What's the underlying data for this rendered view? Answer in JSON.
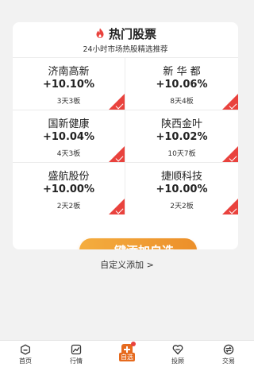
{
  "header": {
    "title": "热门股票",
    "subtitle": "24小时市场热股精选推荐"
  },
  "stocks": [
    {
      "name": "济南高新",
      "change": "+10.10%",
      "streak": "3天3板",
      "selected": true
    },
    {
      "name": "新 华 都",
      "change": "+10.06%",
      "streak": "8天4板",
      "selected": true
    },
    {
      "name": "国新健康",
      "change": "+10.04%",
      "streak": "4天3板",
      "selected": true
    },
    {
      "name": "陕西金叶",
      "change": "+10.02%",
      "streak": "10天7板",
      "selected": true
    },
    {
      "name": "盛航股份",
      "change": "+10.00%",
      "streak": "2天2板",
      "selected": true
    },
    {
      "name": "捷顺科技",
      "change": "+10.00%",
      "streak": "2天2板",
      "selected": true
    }
  ],
  "actions": {
    "add_all_label": "一键添加自选",
    "custom_add_label": "自定义添加 >"
  },
  "tabbar": {
    "items": [
      {
        "label": "首页",
        "icon": "home-icon"
      },
      {
        "label": "行情",
        "icon": "chart-icon"
      },
      {
        "label": "自选",
        "icon": "plus-square-icon",
        "active": true
      },
      {
        "label": "投顾",
        "icon": "heart-shield-icon"
      },
      {
        "label": "交易",
        "icon": "exchange-icon"
      }
    ]
  },
  "colors": {
    "accent": "#ec8f2a",
    "accent_light": "#f4ad3f",
    "selected_corner": "#e9423d",
    "active_tab": "#e66a1e",
    "page_bg": "#f2f2f2"
  }
}
